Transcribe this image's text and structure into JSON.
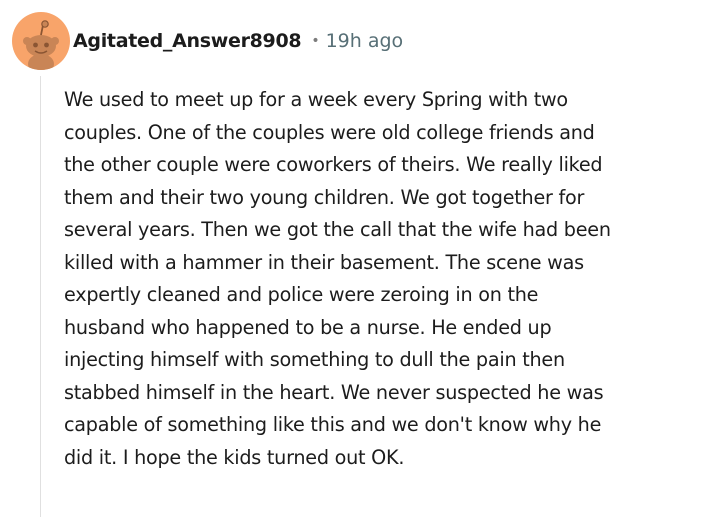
{
  "comment": {
    "author": "Agitated_Answer8908",
    "separator": "•",
    "timestamp": "19h ago",
    "body_lines": [
      "We used to meet up for a week every Spring with two",
      "couples. One of the couples were old college friends and",
      "the other couple were coworkers of theirs. We really liked",
      "them and their two young children. We got together for",
      "several years. Then we got the call that the wife had been",
      "killed with a hammer in their basement. The scene was",
      "expertly cleaned and police were zeroing in on the",
      "husband who happened to be a nurse. He ended up",
      "injecting himself with something to dull the pain then",
      "stabbed himself in the heart. We never suspected he was",
      "capable of something like this and we don't know why he",
      "did it. I hope the kids turned out OK."
    ]
  },
  "colors": {
    "avatar_background": "#f8a46a",
    "text": "#1c1c1c",
    "muted": "#576f76",
    "thread_line": "#e0e0e0"
  },
  "icons": {
    "avatar": "snoo-avatar-icon"
  }
}
